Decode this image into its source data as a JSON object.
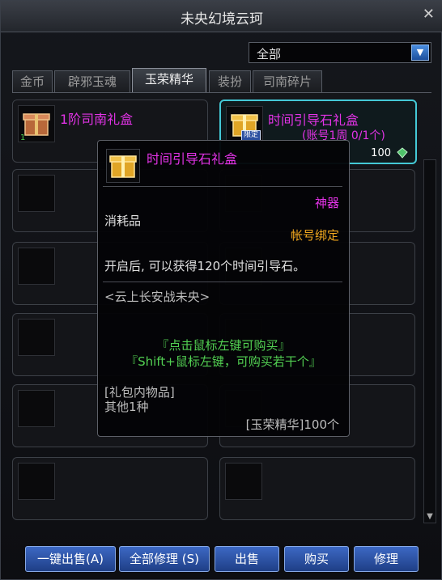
{
  "window": {
    "title": "未央幻境云珂",
    "close_glyph": "✕"
  },
  "filter": {
    "selected": "全部"
  },
  "tabs": [
    {
      "label": "金币"
    },
    {
      "label": "辟邪玉魂"
    },
    {
      "label": "玉荣精华",
      "active": true
    },
    {
      "label": "装扮"
    },
    {
      "label": "司南碎片"
    }
  ],
  "items": [
    {
      "name": "1阶司南礼盒",
      "qty": "1"
    },
    {
      "name": "时间引导石礼盒",
      "sub": "(账号1周 0/1个)",
      "price": "100",
      "badge": "限定"
    }
  ],
  "tooltip": {
    "title": "时间引导石礼盒",
    "grade": "神器",
    "type": "消耗品",
    "bind": "帐号绑定",
    "desc": "开启后, 可以获得120个时间引导石。",
    "source": "<云上长安战未央>",
    "hint1": "『点击鼠标左键可购买』",
    "hint2": "『Shift+鼠标左键，可购买若干个』",
    "contents_label": "[礼包内物品]",
    "contents_value": "其他1种",
    "cost": "[玉荣精华]100个"
  },
  "buttons": {
    "sell_all": "一键出售(A)",
    "repair_all": "全部修理 (S)",
    "sell": "出售",
    "buy": "购买",
    "repair": "修理"
  },
  "colors": {
    "rare_name": "#e233e6",
    "bind": "#f2a81e",
    "hint": "#52d052",
    "highlight_border": "#44c9d6",
    "button": "#2c55a8"
  },
  "icons": [
    "close-icon",
    "dropdown-arrow-icon",
    "gift-box-icon",
    "gem-currency-icon",
    "scroll-down-icon"
  ]
}
